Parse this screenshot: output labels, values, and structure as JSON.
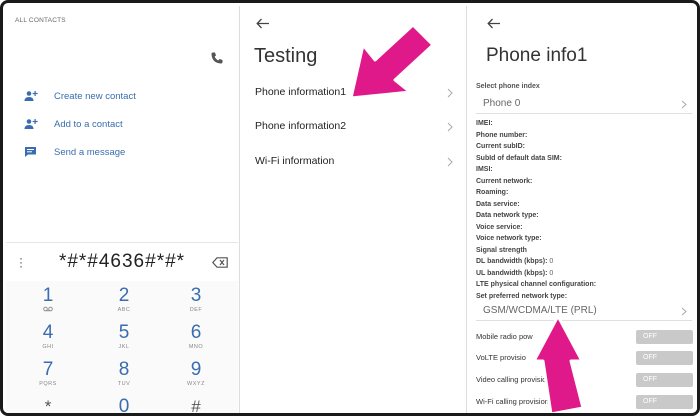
{
  "dialer": {
    "header": "ALL CONTACTS",
    "actions": [
      {
        "label": "Create new contact",
        "icon": "add-person-icon"
      },
      {
        "label": "Add to a contact",
        "icon": "add-person-icon"
      },
      {
        "label": "Send a message",
        "icon": "message-icon"
      }
    ],
    "number": "*#*#4636#*#*",
    "keys": [
      {
        "digit": "1",
        "letters": "QO"
      },
      {
        "digit": "2",
        "letters": "ABC"
      },
      {
        "digit": "3",
        "letters": "DEF"
      },
      {
        "digit": "4",
        "letters": "GHI"
      },
      {
        "digit": "5",
        "letters": "JKL"
      },
      {
        "digit": "6",
        "letters": "MNO"
      },
      {
        "digit": "7",
        "letters": "PQRS"
      },
      {
        "digit": "8",
        "letters": "TUV"
      },
      {
        "digit": "9",
        "letters": "WXYZ"
      },
      {
        "digit": "*",
        "letters": ""
      },
      {
        "digit": "0",
        "letters": ""
      },
      {
        "digit": "#",
        "letters": ""
      }
    ]
  },
  "testing": {
    "title": "Testing",
    "items": [
      "Phone information1",
      "Phone information2",
      "Wi-Fi information"
    ]
  },
  "phone_info": {
    "title": "Phone info1",
    "select_label": "Select phone index",
    "phone_index": "Phone 0",
    "fields": [
      {
        "label": "IMEI:",
        "value": ""
      },
      {
        "label": "Phone number:",
        "value": ""
      },
      {
        "label": "Current subID:",
        "value": ""
      },
      {
        "label": "SubId of default data SIM:",
        "value": ""
      },
      {
        "label": "IMSI:",
        "value": ""
      },
      {
        "label": "Current network:",
        "value": ""
      },
      {
        "label": "Roaming:",
        "value": ""
      },
      {
        "label": "Data service:",
        "value": ""
      },
      {
        "label": "Data network type:",
        "value": ""
      },
      {
        "label": "Voice service:",
        "value": ""
      },
      {
        "label": "Voice network type:",
        "value": ""
      },
      {
        "label": "Signal strength",
        "value": ""
      },
      {
        "label": "DL bandwidth (kbps):",
        "value": "0"
      },
      {
        "label": "UL bandwidth (kbps):",
        "value": "0"
      },
      {
        "label": "LTE physical channel configuration:",
        "value": ""
      }
    ],
    "preferred_label": "Set preferred network type:",
    "preferred_value": "GSM/WCDMA/LTE (PRL)",
    "toggles": [
      {
        "label": "Mobile radio pow",
        "state": "OFF"
      },
      {
        "label": "VoLTE provisio",
        "state": "OFF"
      },
      {
        "label": "Video calling provisio",
        "state": "OFF"
      },
      {
        "label": "Wi-Fi calling provision",
        "state": "OFF"
      }
    ]
  },
  "colors": {
    "accent": "#3a6cb0",
    "arrow": "#e0198a",
    "toggle_off": "#c9c9c9"
  }
}
